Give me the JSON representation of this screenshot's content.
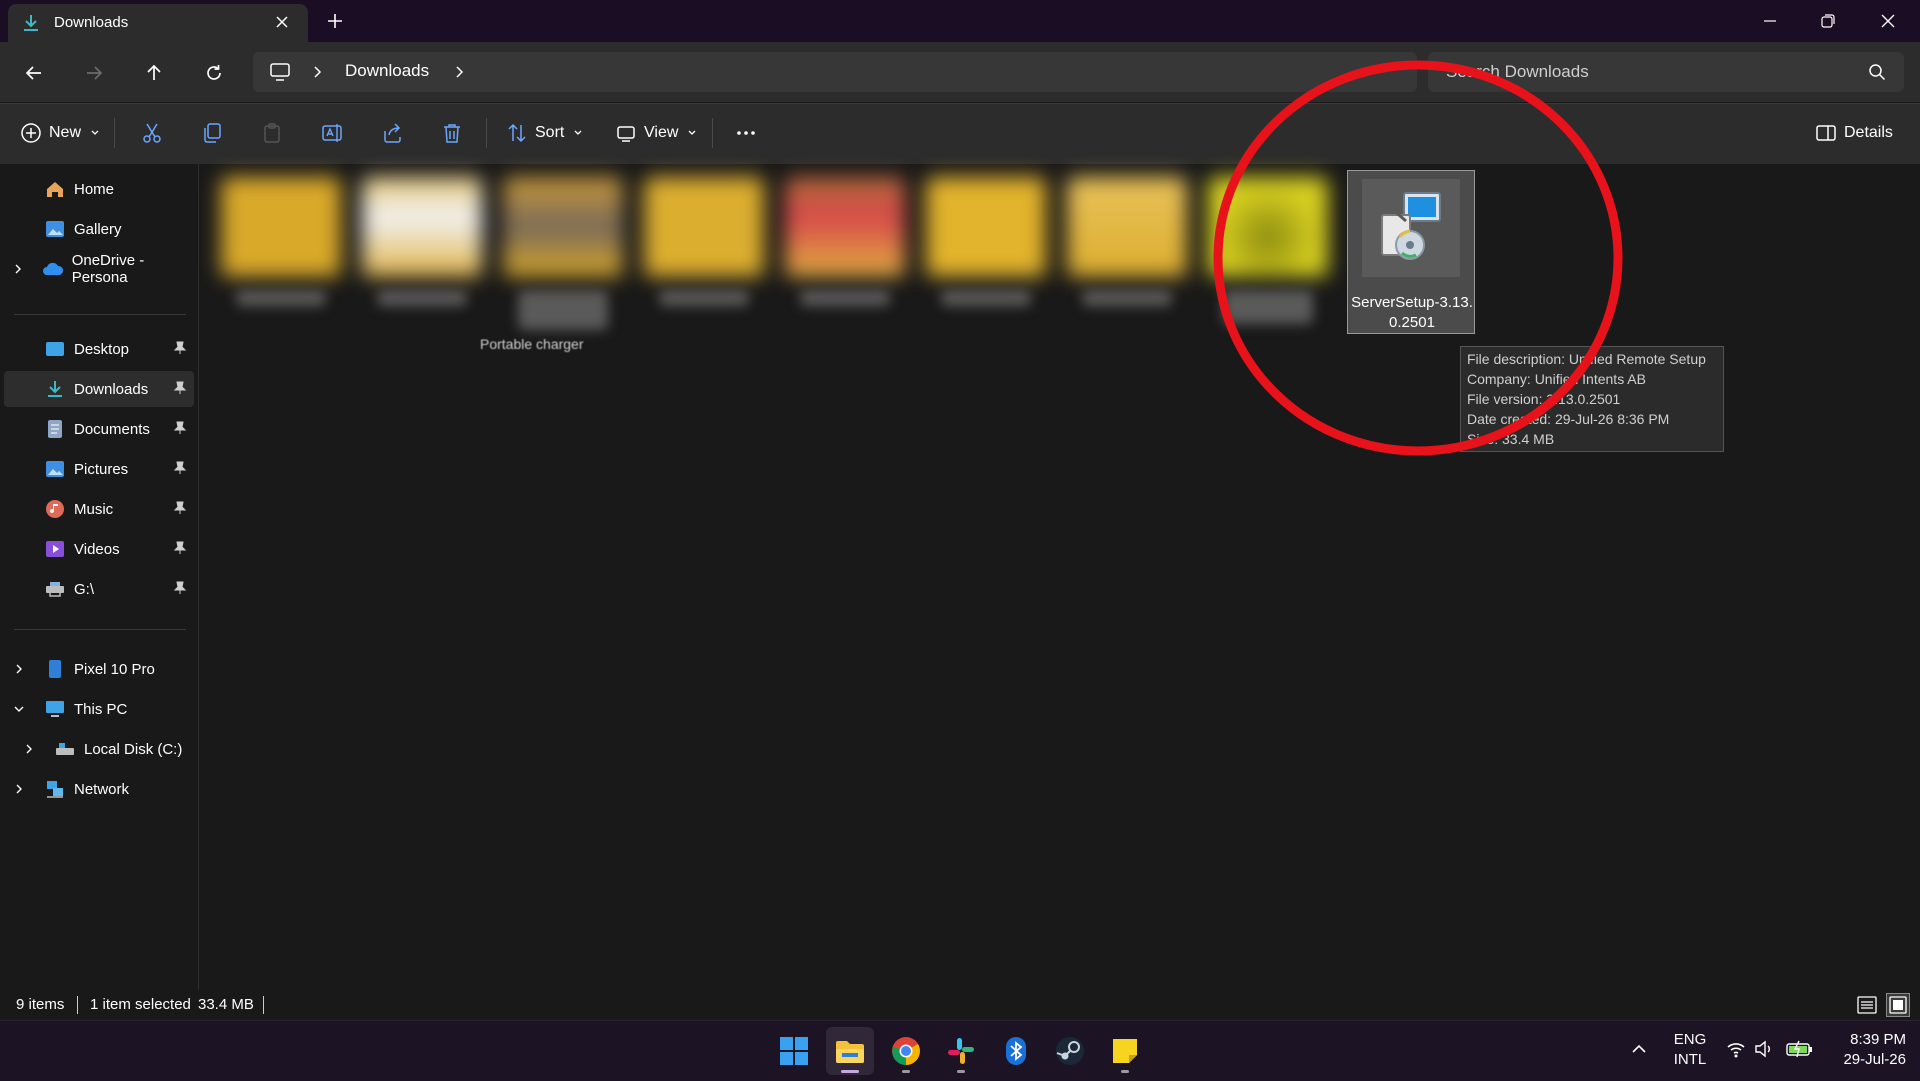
{
  "window": {
    "tab_title": "Downloads",
    "tab_icon": "download-arrow-icon",
    "new_tab_icon": "plus-icon",
    "controls": [
      "minimize-icon",
      "restore-icon",
      "close-icon"
    ]
  },
  "nav": {
    "buttons": [
      "back-arrow-icon",
      "forward-arrow-icon",
      "up-arrow-icon",
      "refresh-icon"
    ],
    "breadcrumb": [
      "Downloads"
    ],
    "search_placeholder": "Search Downloads"
  },
  "toolbar": {
    "new_label": "New",
    "sort_label": "Sort",
    "view_label": "View",
    "details_label": "Details",
    "icons": [
      "cut-icon",
      "copy-icon",
      "paste-icon",
      "rename-icon",
      "share-icon",
      "delete-icon",
      "more-icon"
    ]
  },
  "sidebar": {
    "quick": [
      {
        "label": "Home",
        "icon": "home-icon"
      },
      {
        "label": "Gallery",
        "icon": "gallery-icon"
      },
      {
        "label": "OneDrive - Persona",
        "icon": "onedrive-cloud-icon"
      }
    ],
    "pinned": [
      {
        "label": "Desktop",
        "icon": "desktop-folder-icon"
      },
      {
        "label": "Downloads",
        "icon": "download-arrow-icon"
      },
      {
        "label": "Documents",
        "icon": "documents-icon"
      },
      {
        "label": "Pictures",
        "icon": "pictures-icon"
      },
      {
        "label": "Music",
        "icon": "music-icon"
      },
      {
        "label": "Videos",
        "icon": "videos-icon"
      },
      {
        "label": "G:\\",
        "icon": "network-drive-icon"
      }
    ],
    "devices": [
      {
        "label": "Pixel 10 Pro",
        "icon": "phone-icon"
      },
      {
        "label": "This PC",
        "icon": "this-pc-icon"
      },
      {
        "label": "Local Disk (C:)",
        "icon": "local-disk-icon"
      },
      {
        "label": "Network",
        "icon": "network-icon"
      }
    ]
  },
  "content": {
    "stray_caption": "Portable charger",
    "selected_file": {
      "name_line1": "ServerSetup-3.13.",
      "name_line2": "0.2501",
      "icon": "installer-icon"
    },
    "tooltip": {
      "line1": "File description: Unified Remote Setup",
      "line2": "Company: Unified Intents AB",
      "line3": "File version: 3.13.0.2501",
      "line4": "Date created: 29-Jul-26 8:36 PM",
      "line5": "Size: 33.4 MB"
    },
    "highlight_color": "#e8121b"
  },
  "status": {
    "items": "9 items",
    "selected": "1 item selected",
    "size": "33.4 MB"
  },
  "taskbar": {
    "apps": [
      "windows-start-icon",
      "file-explorer-icon",
      "chrome-icon",
      "slack-icon",
      "bluetooth-icon",
      "steam-icon",
      "sticky-notes-icon"
    ],
    "lang_line1": "ENG",
    "lang_line2": "INTL",
    "time": "8:39 PM",
    "date": "29-Jul-26"
  }
}
